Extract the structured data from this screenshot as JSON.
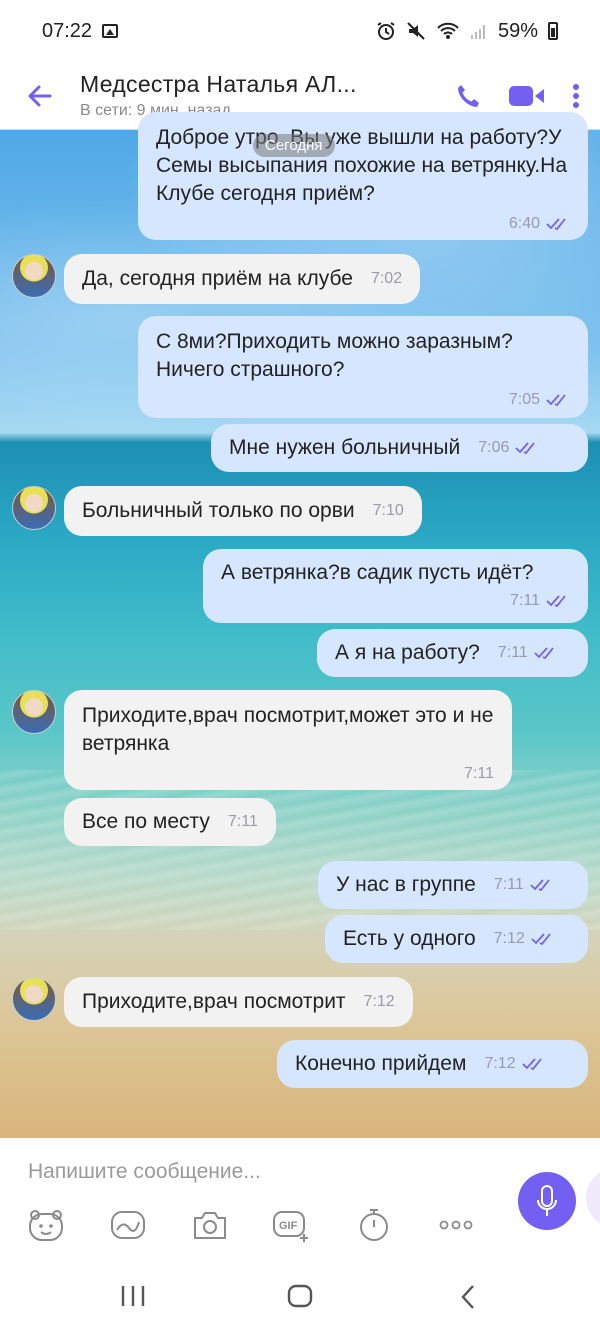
{
  "status_bar": {
    "time": "07:22",
    "battery": "59%"
  },
  "header": {
    "title": "Медсестра Наталья АЛ...",
    "subtitle": "В сети: 9 мин. назад"
  },
  "date_separator": "Сегодня",
  "messages": [
    {
      "dir": "out",
      "text": "Доброе утро. Вы уже вышли на работу?У Семы высыпания похожие на ветрянку.На Клубе сегодня приём?",
      "time": "6:40",
      "read": true
    },
    {
      "dir": "in",
      "text": "Да, сегодня приём на клубе",
      "time": "7:02"
    },
    {
      "dir": "out",
      "text": "С 8ми?Приходить можно заразным? Ничего страшного?",
      "time": "7:05",
      "read": true
    },
    {
      "dir": "out",
      "text": "Мне нужен больничный",
      "time": "7:06",
      "read": true
    },
    {
      "dir": "in",
      "text": "Больничный только по орви",
      "time": "7:10"
    },
    {
      "dir": "out",
      "text": "А ветрянка?в садик пусть идёт?",
      "time": "7:11",
      "read": true
    },
    {
      "dir": "out",
      "text": "А я на работу?",
      "time": "7:11",
      "read": true
    },
    {
      "dir": "in",
      "text": "Приходите,врач посмотрит,может это и не ветрянка",
      "time": "7:11"
    },
    {
      "dir": "in",
      "text": "Все по месту",
      "time": "7:11"
    },
    {
      "dir": "out",
      "text": "У нас в группе",
      "time": "7:11",
      "read": true
    },
    {
      "dir": "out",
      "text": "Есть у одного",
      "time": "7:12",
      "read": true
    },
    {
      "dir": "in",
      "text": "Приходите,врач посмотрит",
      "time": "7:12"
    },
    {
      "dir": "out",
      "text": "Конечно прийдем",
      "time": "7:12",
      "read": true
    }
  ],
  "composer": {
    "placeholder": "Напишите сообщение..."
  },
  "accent_color": "#7360f2",
  "tool_icons": [
    "sticker-icon",
    "doodle-icon",
    "camera-icon",
    "gif-icon",
    "timer-icon",
    "more-icon"
  ]
}
